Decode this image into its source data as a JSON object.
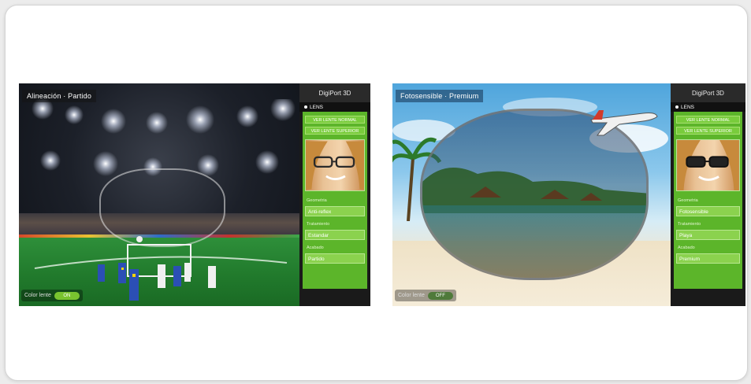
{
  "panels": [
    {
      "title": "Alineación · Partido",
      "toggle_label": "Color lente",
      "toggle_value": "ON",
      "config": {
        "header": "DigiPort 3D",
        "section": "LENS",
        "buttons": [
          "VER LENTE NORMAL",
          "VER LENTE SUPERIOR"
        ],
        "fields": [
          {
            "label": "Geometria",
            "value": "Anti-reflex"
          },
          {
            "label": "Tratamiento",
            "value": "Estandar"
          },
          {
            "label": "Acabado",
            "value": "Partido"
          }
        ]
      }
    },
    {
      "title": "Fotosensible · Premium",
      "toggle_label": "Color lente",
      "toggle_value": "OFF",
      "config": {
        "header": "DigiPort 3D",
        "section": "LENS",
        "buttons": [
          "VER LENTE NORMAL",
          "VER LENTE SUPERIOR"
        ],
        "fields": [
          {
            "label": "Geometria",
            "value": "Fotosensible"
          },
          {
            "label": "Tratamiento",
            "value": "Playa"
          },
          {
            "label": "Acabado",
            "value": "Premium"
          }
        ]
      }
    }
  ],
  "colors": {
    "panel_green": "#5cb52a",
    "button_green": "#79cc3c",
    "dark": "#1a1a1a"
  },
  "icons": [
    "glasses-face-icon",
    "airplane-icon",
    "toggle-switch-icon"
  ]
}
